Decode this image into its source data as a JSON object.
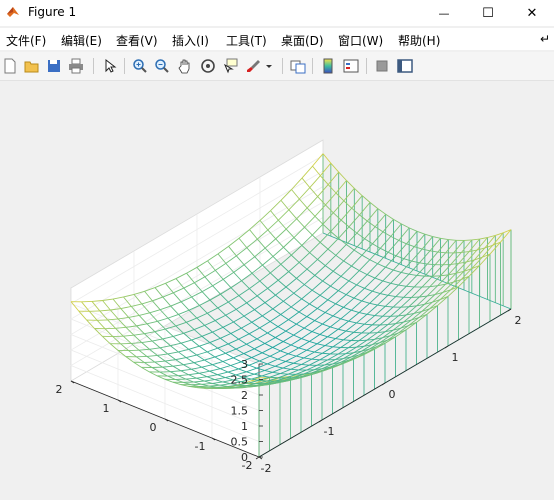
{
  "window": {
    "title": "Figure 1",
    "minimize_glyph": "—",
    "maximize_glyph": "☐",
    "close_glyph": "✕"
  },
  "menu": {
    "items": [
      "文件(F)",
      "编辑(E)",
      "查看(V)",
      "插入(I)",
      "工具(T)",
      "桌面(D)",
      "窗口(W)",
      "帮助(H)"
    ],
    "overflow_glyph": "↵"
  },
  "toolbar": {
    "icons": [
      "new-figure-icon",
      "open-file-icon",
      "save-icon",
      "print-icon",
      "pointer-icon",
      "zoom-in-icon",
      "zoom-out-icon",
      "pan-hand-icon",
      "rotate-3d-icon",
      "data-cursor-icon",
      "brush-icon",
      "brush-dropdown-icon",
      "link-plot-icon",
      "colorbar-icon",
      "legend-icon",
      "hide-plot-tools-icon",
      "show-plot-tools-icon"
    ]
  },
  "colors": {
    "surface_low": "#1fa5a0",
    "surface_mid": "#8cc86f",
    "surface_high": "#fbd632",
    "matlab_orange": "#e06c20"
  },
  "chart_data": {
    "type": "surface-mesh-3d",
    "function": "z = x^2/2 + y^2/2 style bowl (approx.)",
    "x_range": [
      -2,
      2
    ],
    "y_range": [
      -2,
      2
    ],
    "z_range": [
      0,
      3
    ],
    "x_ticks": [
      "-2",
      "-1",
      "0",
      "1",
      "2"
    ],
    "y_ticks": [
      "-2",
      "-1",
      "0",
      "1",
      "2"
    ],
    "z_ticks": [
      "0",
      "0.5",
      "1",
      "1.5",
      "2",
      "2.5",
      "3"
    ],
    "grid": true,
    "curtain": true
  }
}
